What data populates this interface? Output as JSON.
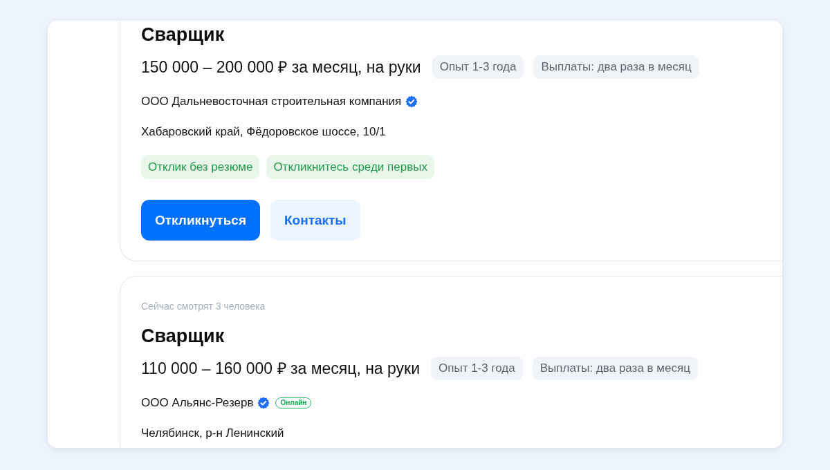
{
  "vacancies": [
    {
      "title": "Сварщик",
      "salary": "150 000 – 200 000 ₽ за месяц, на руки",
      "chips": [
        "Опыт 1-3 года",
        "Выплаты: два раза в месяц"
      ],
      "company": "ООО Дальневосточная строительная компания",
      "verified": true,
      "address": "Хабаровский край, Фёдоровское шоссе, 10/1",
      "tags": [
        "Отклик без резюме",
        "Откликнитесь среди первых"
      ],
      "actions": [
        {
          "label": "Откликнуться",
          "kind": "primary"
        },
        {
          "label": "Контакты",
          "kind": "secondary"
        }
      ]
    },
    {
      "viewers": "Сейчас смотрят 3 человека",
      "title": "Сварщик",
      "salary": "110 000 – 160 000 ₽ за месяц, на руки",
      "chips": [
        "Опыт 1-3 года",
        "Выплаты: два раза в месяц"
      ],
      "company": "ООО Альянс-Резерв",
      "verified": true,
      "status_badge": "Онлайн",
      "address": "Челябинск, р-н Ленинский"
    }
  ]
}
